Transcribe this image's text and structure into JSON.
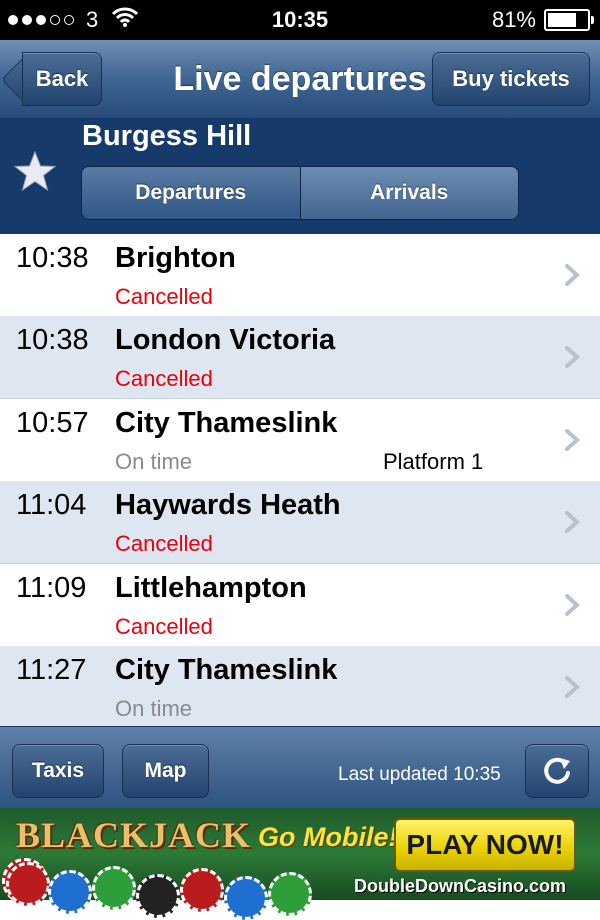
{
  "status_bar": {
    "carrier": "3",
    "time": "10:35",
    "battery": "81%",
    "battery_level": 0.81,
    "signal_bars": 3,
    "signal_max": 5
  },
  "nav": {
    "back_label": "Back",
    "title": "Live departures",
    "buy_label": "Buy tickets"
  },
  "station": {
    "name": "Burgess Hill",
    "tabs": [
      "Departures",
      "Arrivals"
    ],
    "selected_tab": "Departures"
  },
  "departures": [
    {
      "time": "10:38",
      "destination": "Brighton",
      "status": "Cancelled",
      "platform": ""
    },
    {
      "time": "10:38",
      "destination": "London Victoria",
      "status": "Cancelled",
      "platform": ""
    },
    {
      "time": "10:57",
      "destination": "City Thameslink",
      "status": "On time",
      "platform": "Platform 1"
    },
    {
      "time": "11:04",
      "destination": "Haywards Heath",
      "status": "Cancelled",
      "platform": ""
    },
    {
      "time": "11:09",
      "destination": "Littlehampton",
      "status": "Cancelled",
      "platform": ""
    },
    {
      "time": "11:27",
      "destination": "City Thameslink",
      "status": "On time",
      "platform": ""
    }
  ],
  "toolbar": {
    "taxis_label": "Taxis",
    "map_label": "Map",
    "last_updated": "Last updated 10:35"
  },
  "ad": {
    "headline": "BLACKJACK",
    "tagline": "Go Mobile!",
    "cta": "PLAY NOW!",
    "domain": "DoubleDownCasino.com"
  },
  "colors": {
    "cancelled": "#e8000b",
    "on_time": "#8a8a8a",
    "nav_blue": "#3f6592",
    "station_blue": "#163a6a",
    "row_alt": "#dde6f1"
  },
  "icons": {
    "favorite": "star-icon",
    "row_disclosure": "chevron-right-icon",
    "refresh": "refresh-icon",
    "wifi": "wifi-icon",
    "battery": "battery-icon"
  }
}
